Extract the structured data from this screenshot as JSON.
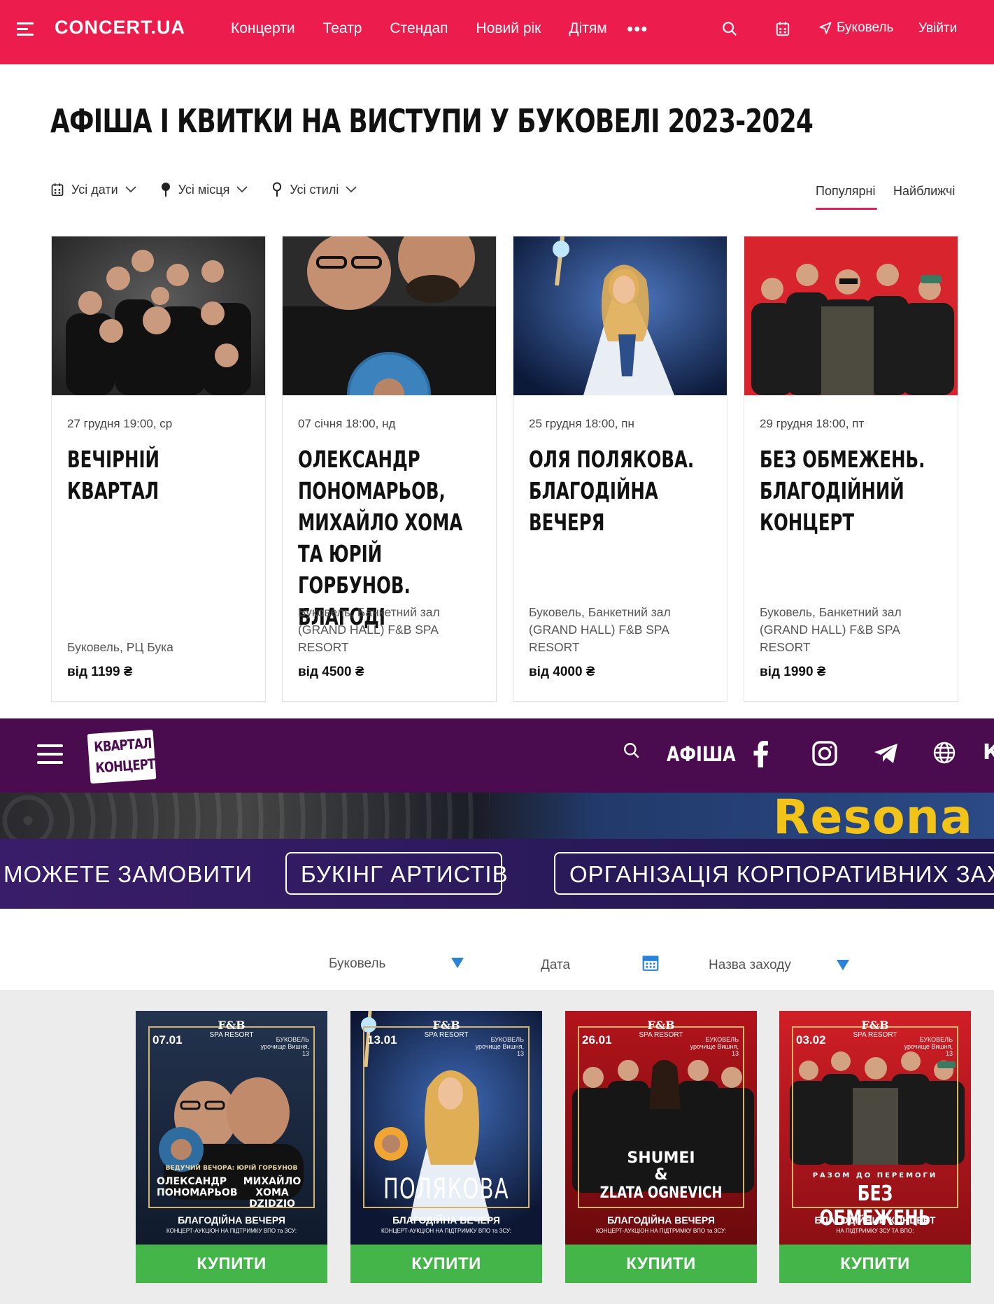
{
  "concert_ua": {
    "logo": "CONCERT.UA",
    "nav": [
      "Концерти",
      "Театр",
      "Стендап",
      "Новий рік",
      "Дітям"
    ],
    "more": "•••",
    "city": "Буковель",
    "login": "Увійти",
    "page_title": "АФІША І КВИТКИ НА ВИСТУПИ У БУКОВЕЛІ 2023-2024",
    "filters": {
      "dates": "Усі дати",
      "places": "Усі місця",
      "styles": "Усі стилі"
    },
    "sort": {
      "popular": "Популярні",
      "nearest": "Найближчі"
    },
    "events": [
      {
        "date": "27 грудня 19:00, ср",
        "title": "ВЕЧІРНІЙ КВАРТАЛ",
        "venue": "Буковель, РЦ Бука",
        "price": "від 1199 ₴"
      },
      {
        "date": "07 січня 18:00, нд",
        "title": "ОЛЕКСАНДР ПОНОМАРЬОВ, МИХАЙЛО ХОМА ТА ЮРІЙ ГОРБУНОВ. БЛАГОДІ",
        "venue": "Буковель, Банкетний зал (GRAND HALL) F&B SPA RESORT",
        "price": "від 4500 ₴"
      },
      {
        "date": "25 грудня 18:00, пн",
        "title": "ОЛЯ ПОЛЯКОВА. БЛАГОДІЙНА ВЕЧЕРЯ",
        "venue": "Буковель, Банкетний зал (GRAND HALL) F&B SPA RESORT",
        "price": "від 4000 ₴"
      },
      {
        "date": "29 грудня 18:00, пт",
        "title": "БЕЗ ОБМЕЖЕНЬ. БЛАГОДІЙНИЙ КОНЦЕРТ",
        "venue": "Буковель, Банкетний зал (GRAND HALL) F&B SPA RESORT",
        "price": "від 1990 ₴"
      }
    ]
  },
  "kvartal": {
    "logo_line1": "КВАРТАЛ",
    "logo_line2": "КОНЦЕРТ",
    "afisha": "АФІША",
    "cut_letter": "К",
    "banner_word": "Resona",
    "strip_text": "МОЖЕТЕ ЗАМОВИТИ",
    "strip_pill1": "БУКІНГ АРТИСТІВ",
    "strip_pill2": "ОРГАНІЗАЦІЯ КОРПОРАТИВНИХ ЗАХО",
    "filter_city": "Буковель",
    "filter_date": "Дата",
    "filter_event": "Назва заходу",
    "posters": [
      {
        "date": "07.01",
        "brand": "F&B",
        "brand_sub": "SPA RESORT",
        "location": "БУКОВЕЛЬ урочище Вишня, 13",
        "name1": "ОЛЕКСАНДР ПОНОМАРЬОВ",
        "name2": "МИХАЙЛО ХОМА DZIDZIO",
        "host": "ВЕДУЧИЙ ВЕЧОРА: ЮРІЙ ГОРБУНОВ",
        "line": "БЛАГОДІЙНА ВЕЧЕРЯ",
        "line_sub": "КОНЦЕРТ-АУКЦІОН НА ПІДТРИМКУ ВПО та ЗСУ:",
        "buy": "КУПИТИ"
      },
      {
        "date": "13.01",
        "brand": "F&B",
        "brand_sub": "SPA RESORT",
        "location": "БУКОВЕЛЬ урочище Вишня, 13",
        "name1": "ПОЛЯКОВА",
        "name2": "",
        "host": "",
        "line": "БЛАГОДІЙНА ВЕЧЕРЯ",
        "line_sub": "КОНЦЕРТ-АУКЦІОН НА ПІДТРИМКУ ВПО та ЗСУ:",
        "buy": "КУПИТИ"
      },
      {
        "date": "26.01",
        "brand": "F&B",
        "brand_sub": "SPA RESORT",
        "location": "БУКОВЕЛЬ урочище Вишня, 13",
        "name1": "SHUMEI",
        "name2": "&",
        "name3": "ZLATA OGNEVICH",
        "host": "",
        "line": "БЛАГОДІЙНА ВЕЧЕРЯ",
        "line_sub": "КОНЦЕРТ-АУКЦІОН НА ПІДТРИМКУ ВПО та ЗСУ:",
        "buy": "КУПИТИ"
      },
      {
        "date": "03.02",
        "brand": "F&B",
        "brand_sub": "SPA RESORT",
        "location": "БУКОВЕЛЬ урочище Вишня, 13",
        "name1": "БЕЗ ОБМЕЖЕНЬ",
        "name2": "",
        "host": "РАЗОМ ДО ПЕРЕМОГИ",
        "line": "БЛАГОДІЙНИЙ КОНЦЕРТ",
        "line_sub": "НА ПІДТРИМКУ ЗСУ ТА ВПО:",
        "buy": "КУПИТИ"
      }
    ]
  }
}
